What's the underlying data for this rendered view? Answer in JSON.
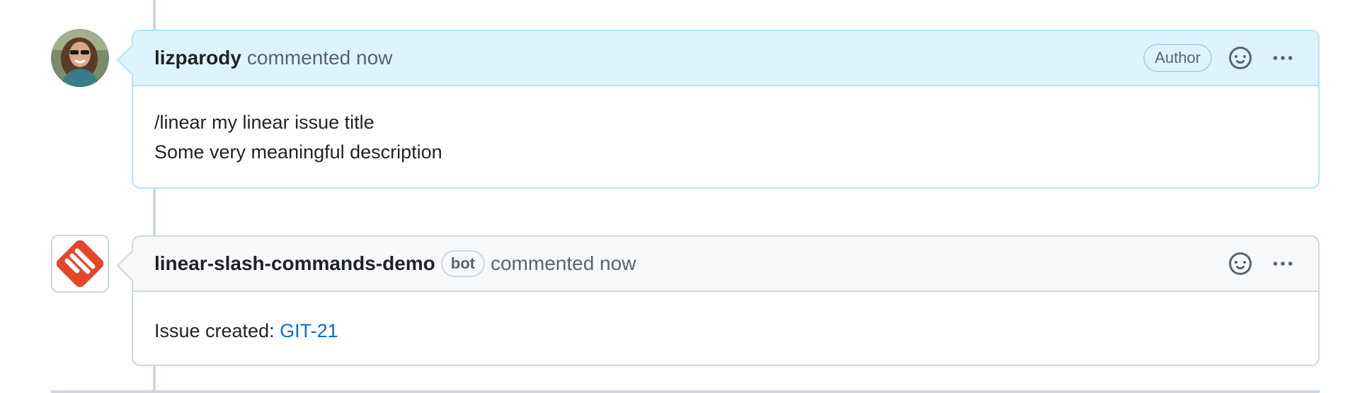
{
  "comments": [
    {
      "author": "lizparody",
      "meta": "commented now",
      "author_label": "Author",
      "body_lines": [
        "/linear my linear issue title",
        "Some very meaningful description"
      ],
      "avatar_icon": "user-photo-avatar",
      "header_color": "#ddf4ff",
      "border_color": "#b6e3ff"
    },
    {
      "author": "linear-slash-commands-demo",
      "badge": "bot",
      "meta": "commented now",
      "body_prefix": "Issue created: ",
      "link_text": "GIT-21",
      "avatar_icon": "linear-logo-icon",
      "header_color": "#f6f8fa",
      "border_color": "#d0d7de",
      "link_color": "#0969da",
      "logo_color": "#e5462a"
    }
  ],
  "icons": {
    "reaction": "smiley-icon",
    "more": "kebab-horizontal-icon"
  }
}
